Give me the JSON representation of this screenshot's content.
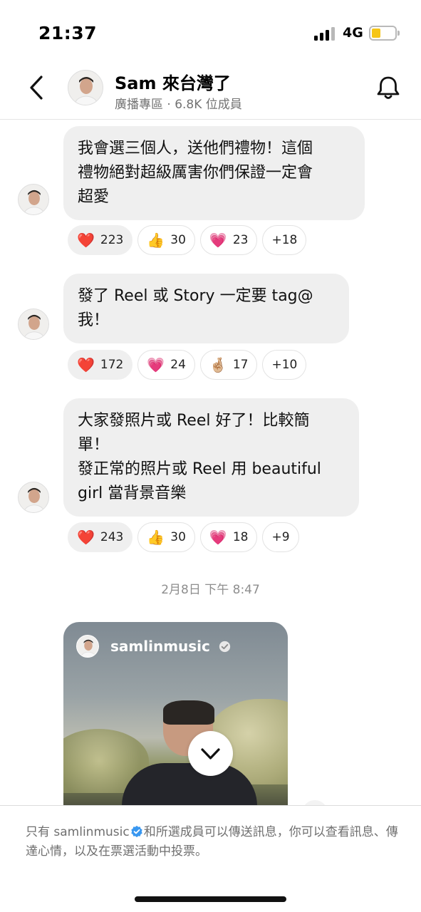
{
  "status": {
    "time": "21:37",
    "network": "4G"
  },
  "header": {
    "title": "Sam 來台灣了",
    "subtitle": "廣播專區 · 6.8K 位成員"
  },
  "messages": [
    {
      "lines": [
        "我會選三個人，送他們禮物！這個",
        "禮物絕對超級厲害你們保證一定會",
        "超愛"
      ],
      "reactions": [
        {
          "emoji": "❤️",
          "count": "223"
        },
        {
          "emoji": "👍",
          "count": "30"
        },
        {
          "emoji": "💗",
          "count": "23"
        }
      ],
      "more": "+18"
    },
    {
      "lines": [
        "發了 Reel 或 Story 一定要 tag@",
        "我！"
      ],
      "reactions": [
        {
          "emoji": "❤️",
          "count": "172"
        },
        {
          "emoji": "💗",
          "count": "24"
        },
        {
          "emoji": "🤞🏼",
          "count": "17"
        }
      ],
      "more": "+10"
    },
    {
      "lines": [
        "大家發照片或 Reel 好了！比較簡",
        "單！",
        "發正常的照片或 Reel 用 beautiful",
        "girl 當背景音樂"
      ],
      "reactions": [
        {
          "emoji": "❤️",
          "count": "243"
        },
        {
          "emoji": "👍",
          "count": "30"
        },
        {
          "emoji": "💗",
          "count": "18"
        }
      ],
      "more": "+9"
    }
  ],
  "date_stamp": "2月8日 下午 8:47",
  "shared_reel": {
    "username": "samlinmusic"
  },
  "footer": {
    "prefix": "只有 samlinmusic",
    "suffix": "和所選成員可以傳送訊息，你可以查看訊息、傳達心情，以及在票選活動中投票。"
  },
  "colors": {
    "verified": "#3897f0",
    "heart": "#e0245e",
    "battery": "#f5c518"
  }
}
